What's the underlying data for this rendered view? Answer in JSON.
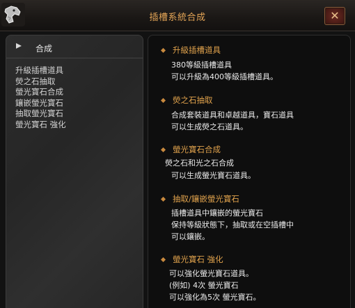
{
  "window": {
    "title": "插槽系統合成",
    "close_icon": "✕"
  },
  "left": {
    "header_label": "合成",
    "items": [
      "升級插槽道具",
      "熒之石抽取",
      "螢光寶石合成",
      "鑲嵌螢光寶石",
      "抽取螢光寶石",
      "螢光寶石 強化"
    ]
  },
  "sections": [
    {
      "title": "升級插槽道具",
      "lines": [
        "380等級插槽道具",
        "可以升級為400等級插槽道具。"
      ]
    },
    {
      "title": "熒之石抽取",
      "lines": [
        "合成套裝道具和卓越道具，寶石道具",
        "可以生成熒之石道具。"
      ]
    },
    {
      "title": "螢光寶石合成",
      "lines": [
        "熒之石和光之石合成",
        "可以生成螢光寶石道具。"
      ]
    },
    {
      "title": "抽取/鑲嵌螢光寶石",
      "lines": [
        "插槽道具中鑲嵌的螢光寶石",
        "保持等級狀態下，抽取或在空插槽中",
        "可以鑲嵌。"
      ]
    },
    {
      "title": "螢光寶石 強化",
      "lines": [
        "可以強化螢光寶石道具。",
        "(例如) 4次 螢光寶石",
        "可以強化為5次 螢光寶石。"
      ]
    }
  ],
  "colors": {
    "accent": "#e0a24c",
    "title": "#e3a456",
    "text": "#e9e9e9"
  },
  "icons": {
    "title_ornament": "dragon-ornament-icon",
    "left_bullet": "triangle-bullet-icon",
    "section_bullet": "diamond-bullet-icon",
    "close": "close-icon"
  }
}
